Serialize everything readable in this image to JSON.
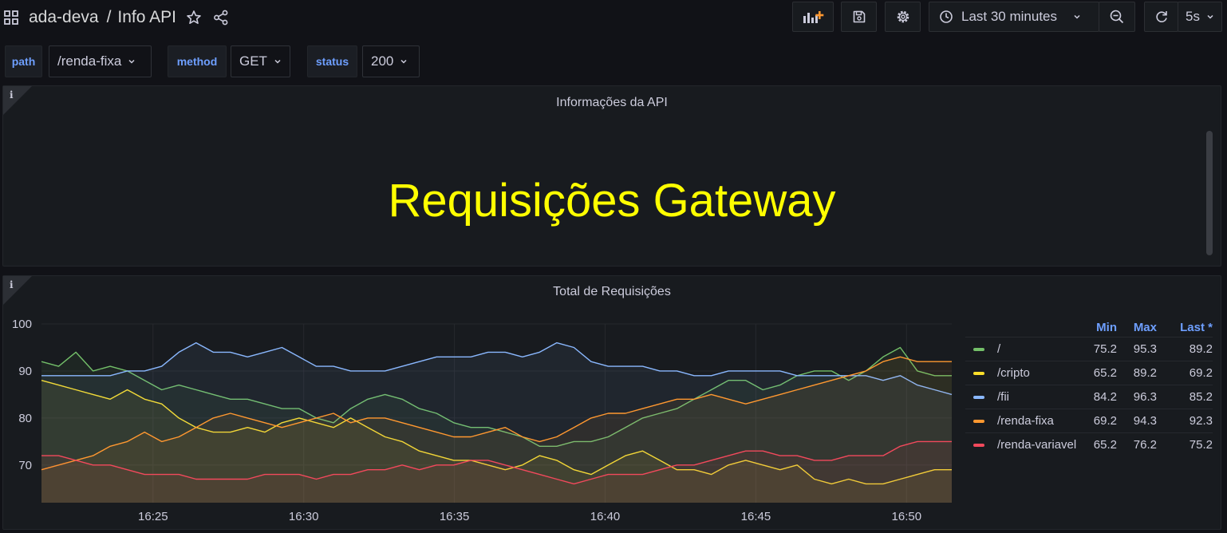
{
  "header": {
    "folder": "ada-deva",
    "separator": "/",
    "dashboard_title": "Info API",
    "time_range": "Last 30 minutes",
    "refresh_interval": "5s",
    "icons": [
      "apps-grid-icon",
      "star-icon",
      "share-icon",
      "add-panel-icon",
      "save-icon",
      "gear-icon",
      "clock-icon",
      "zoom-out-icon",
      "refresh-icon"
    ]
  },
  "variables": [
    {
      "label": "path",
      "value": "/renda-fixa"
    },
    {
      "label": "method",
      "value": "GET"
    },
    {
      "label": "status",
      "value": "200"
    }
  ],
  "text_panel": {
    "title": "Informações da API",
    "content": "Requisições Gateway",
    "content_color": "#ffff00"
  },
  "graph_panel": {
    "title": "Total de Requisições",
    "legend_headers": {
      "min": "Min",
      "max": "Max",
      "last": "Last *"
    }
  },
  "chart_data": {
    "type": "line",
    "title": "Total de Requisições",
    "ylim": [
      62,
      100
    ],
    "y_ticks": [
      100,
      90,
      80,
      70
    ],
    "x_tick_labels": [
      "16:25",
      "16:30",
      "16:35",
      "16:40",
      "16:45",
      "16:50"
    ],
    "x_tick_minutes": [
      25,
      30,
      35,
      40,
      45,
      50
    ],
    "x_range_minutes": [
      21.3,
      51.5
    ],
    "grid": true,
    "fill": true,
    "legend_placement": "right",
    "series": [
      {
        "name": "/",
        "color": "#73bf69",
        "min": "75.2",
        "max": "95.3",
        "last": "89.2",
        "values": [
          92,
          91,
          94,
          90,
          91,
          90,
          88,
          86,
          87,
          86,
          85,
          84,
          84,
          83,
          82,
          82,
          80,
          79,
          82,
          84,
          85,
          84,
          82,
          81,
          79,
          78,
          78,
          77,
          76,
          74,
          74,
          75,
          75,
          76,
          78,
          80,
          81,
          82,
          84,
          86,
          88,
          88,
          86,
          87,
          89,
          90,
          90,
          88,
          90,
          93,
          95,
          90,
          89,
          89
        ]
      },
      {
        "name": "/cripto",
        "color": "#fade2a",
        "min": "65.2",
        "max": "89.2",
        "last": "69.2",
        "values": [
          88,
          87,
          86,
          85,
          84,
          86,
          84,
          83,
          80,
          78,
          77,
          77,
          78,
          77,
          79,
          80,
          79,
          78,
          80,
          78,
          76,
          75,
          73,
          72,
          71,
          71,
          70,
          69,
          70,
          72,
          71,
          69,
          68,
          70,
          72,
          73,
          71,
          69,
          69,
          68,
          70,
          71,
          70,
          69,
          70,
          67,
          66,
          67,
          66,
          66,
          67,
          68,
          69,
          69
        ]
      },
      {
        "name": "/fii",
        "color": "#8ab8ff",
        "min": "84.2",
        "max": "96.3",
        "last": "85.2",
        "values": [
          89,
          89,
          89,
          89,
          89,
          90,
          90,
          91,
          94,
          96,
          94,
          94,
          93,
          94,
          95,
          93,
          91,
          91,
          90,
          90,
          90,
          91,
          92,
          93,
          93,
          93,
          94,
          94,
          93,
          94,
          96,
          95,
          92,
          91,
          91,
          91,
          90,
          90,
          89,
          89,
          90,
          90,
          90,
          90,
          89,
          89,
          89,
          89,
          89,
          88,
          89,
          87,
          86,
          85
        ]
      },
      {
        "name": "/renda-fixa",
        "color": "#ff9830",
        "min": "69.2",
        "max": "94.3",
        "last": "92.3",
        "values": [
          69,
          70,
          71,
          72,
          74,
          75,
          77,
          75,
          76,
          78,
          80,
          81,
          80,
          79,
          78,
          79,
          80,
          81,
          79,
          80,
          80,
          79,
          78,
          77,
          76,
          76,
          77,
          78,
          76,
          75,
          76,
          78,
          80,
          81,
          81,
          82,
          83,
          84,
          84,
          85,
          84,
          83,
          84,
          85,
          86,
          87,
          88,
          89,
          90,
          92,
          93,
          92,
          92,
          92
        ]
      },
      {
        "name": "/renda-variavel",
        "color": "#f2495c",
        "min": "65.2",
        "max": "76.2",
        "last": "75.2",
        "values": [
          72,
          72,
          71,
          70,
          70,
          69,
          68,
          68,
          68,
          67,
          67,
          67,
          67,
          68,
          68,
          68,
          67,
          68,
          68,
          69,
          69,
          70,
          69,
          70,
          70,
          71,
          71,
          70,
          69,
          68,
          67,
          66,
          67,
          68,
          68,
          68,
          69,
          70,
          70,
          71,
          72,
          73,
          73,
          72,
          72,
          71,
          71,
          72,
          72,
          72,
          74,
          75,
          75,
          75
        ]
      }
    ]
  }
}
